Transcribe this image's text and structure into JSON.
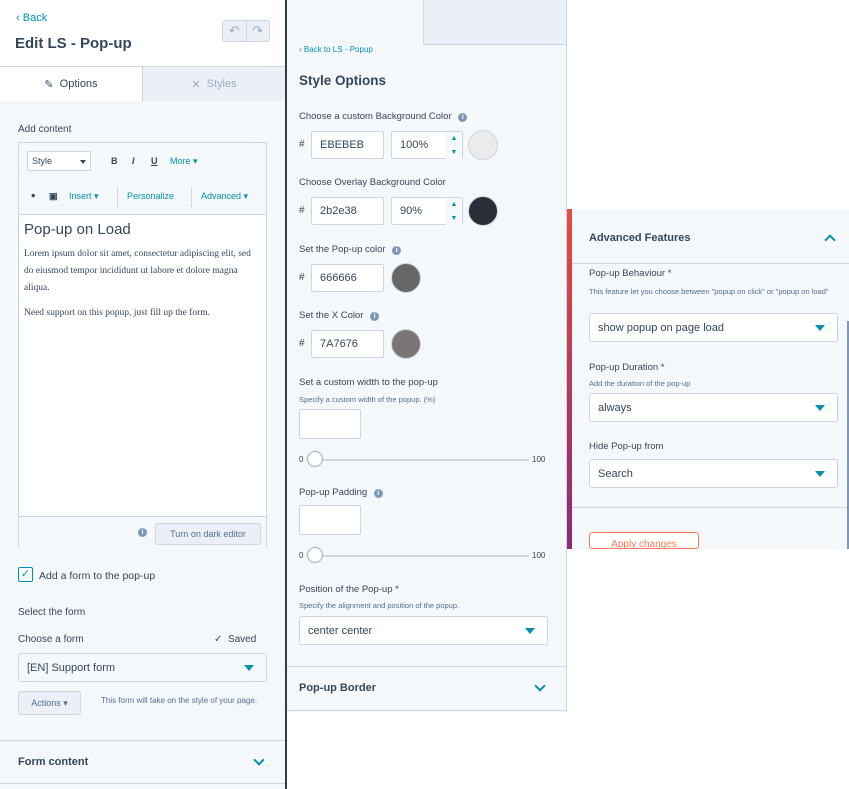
{
  "panel1": {
    "back_label": "Back",
    "title": "Edit LS - Pop-up",
    "undo_icon": "undo-icon",
    "redo_icon": "redo-icon",
    "tabs": [
      {
        "label": "Options",
        "icon": "pencil-icon",
        "active": true
      },
      {
        "label": "Styles",
        "icon": "styles-icon",
        "active": false
      }
    ],
    "add_content_label": "Add content",
    "toolbar": {
      "style_select": "Style",
      "bold": "B",
      "italic": "I",
      "underline": "U",
      "more": "More",
      "insert": "Insert",
      "personalize": "Personalize",
      "advanced": "Advanced"
    },
    "editor": {
      "heading": "Pop-up on Load",
      "paragraph1": "Lorem ipsum dolor sit amet, consectetur adipiscing elit, sed do eiusmod tempor incididunt ut labore et dolore magna aliqua.",
      "paragraph2": "Need support on this popup, just fill up the form."
    },
    "dark_editor_button": "Turn on dark editor",
    "add_form_checkbox": {
      "label": "Add a form to the pop-up",
      "checked": true
    },
    "select_form_label": "Select the form",
    "choose_form_label": "Choose a form",
    "saved_status": "Saved",
    "form_select_value": "[EN] Support form",
    "actions_button": "Actions",
    "form_style_note": "This form will take on the style of your page.",
    "form_content_section": "Form content"
  },
  "panel2": {
    "back_label": "Back to LS - Popup",
    "title": "Style Options",
    "bg_color": {
      "label": "Choose a custom Background Color",
      "hash": "#",
      "hex": "EBEBEB",
      "opacity": "100%",
      "swatch": "#ebebeb"
    },
    "overlay_color": {
      "label": "Choose Overlay Background Color",
      "hash": "#",
      "hex": "2b2e38",
      "opacity": "90%",
      "swatch": "#2b2e38"
    },
    "popup_color": {
      "label": "Set the Pop-up color",
      "hash": "#",
      "hex": "666666",
      "swatch": "#666666"
    },
    "x_color": {
      "label": "Set the X Color",
      "hash": "#",
      "hex": "7A7676",
      "swatch": "#7a7676"
    },
    "width": {
      "label": "Set a custom width to the pop-up",
      "sub": "Specify a custom width of the popup. (%)",
      "value": "",
      "slider_min": "0",
      "slider_max": "100",
      "slider_value": 0
    },
    "padding": {
      "label": "Pop-up Padding",
      "value": "",
      "slider_min": "0",
      "slider_max": "100",
      "slider_value": 0
    },
    "position": {
      "label": "Position of the Pop-up *",
      "sub": "Specify the alignment and position of the popup.",
      "value": "center center"
    },
    "border_section": "Pop-up Border"
  },
  "panel3": {
    "title": "Advanced Features",
    "behaviour": {
      "label": "Pop-up Behaviour *",
      "sub": "This feature let you choose between \"popup on click\" or \"popup on load\"",
      "value": "show popup on page load"
    },
    "duration": {
      "label": "Pop-up Duration *",
      "sub": "Add the duration of the pop-up",
      "value": "always"
    },
    "hide_from": {
      "label": "Hide Pop-up from",
      "value": "Search"
    },
    "apply_button": "Apply changes"
  }
}
